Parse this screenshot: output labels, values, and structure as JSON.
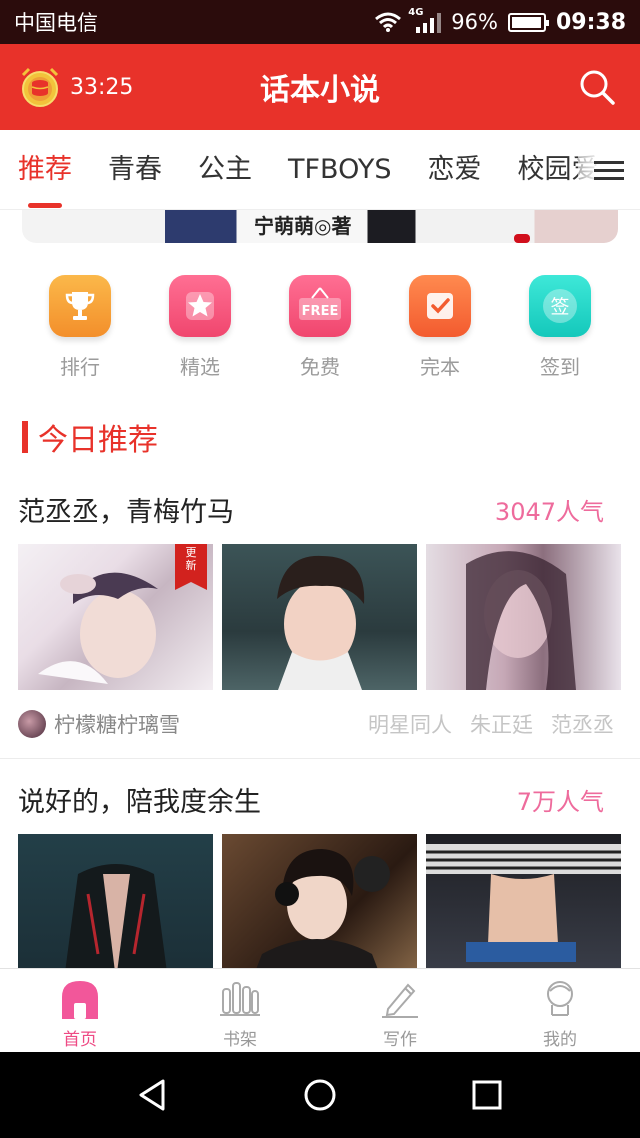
{
  "status_bar": {
    "carrier": "中国电信",
    "network": "4G",
    "battery": "96%",
    "battery_level": 0.96,
    "time": "09:38"
  },
  "header": {
    "timer": "33:25",
    "title": "话本小说",
    "timer_icon": "alarm-clock-coin-icon",
    "search_icon": "search-icon"
  },
  "tabs": [
    {
      "label": "推荐",
      "active": true
    },
    {
      "label": "青春",
      "active": false
    },
    {
      "label": "公主",
      "active": false
    },
    {
      "label": "TFBOYS",
      "active": false
    },
    {
      "label": "恋爱",
      "active": false
    },
    {
      "label": "校园爱",
      "active": false
    }
  ],
  "banner": {
    "caption": "宁萌萌◎著"
  },
  "quick_actions": [
    {
      "label": "排行",
      "icon": "trophy-icon",
      "color": "#f7a43a"
    },
    {
      "label": "精选",
      "icon": "star-icon",
      "color": "#f4567f"
    },
    {
      "label": "免费",
      "icon": "free-sign-icon",
      "color": "#f4567f",
      "icon_text": "FREE"
    },
    {
      "label": "完本",
      "icon": "checkmark-book-icon",
      "color": "#f66a3d"
    },
    {
      "label": "签到",
      "icon": "sign-in-icon",
      "color": "#27d6c9",
      "icon_text": "签"
    }
  ],
  "section": {
    "title": "今日推荐"
  },
  "recommendations": [
    {
      "title": "范丞丞，青梅竹马",
      "popularity": "3047人气",
      "badge": "更新",
      "author": "柠檬糖柠璃雪",
      "tags": [
        "明星同人",
        "朱正廷",
        "范丞丞"
      ]
    },
    {
      "title": "说好的，陪我度余生",
      "popularity": "7万人气"
    }
  ],
  "bottom_nav": [
    {
      "label": "首页",
      "icon": "home-icon",
      "active": true
    },
    {
      "label": "书架",
      "icon": "bookshelf-icon",
      "active": false
    },
    {
      "label": "写作",
      "icon": "pen-icon",
      "active": false
    },
    {
      "label": "我的",
      "icon": "profile-icon",
      "active": false
    }
  ],
  "colors": {
    "brand_red": "#e8322a",
    "popularity_pink": "#ee6b9c",
    "active_nav_pink": "#ee4a84"
  }
}
